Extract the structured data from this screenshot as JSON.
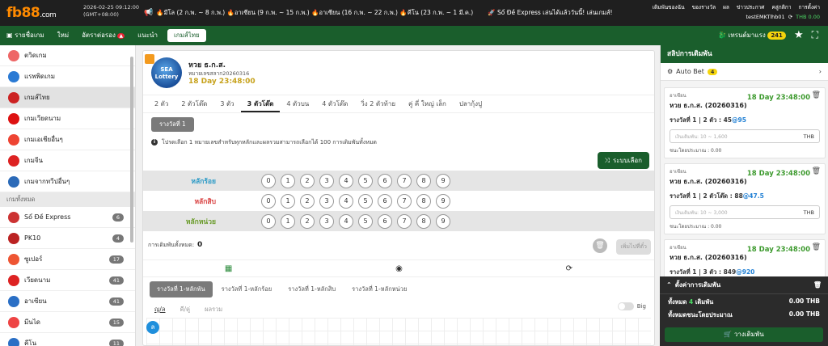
{
  "header": {
    "logo_main": "fb88",
    "logo_dot": ".com",
    "date": "2026-02-25 09:12:00",
    "tz": "(GMT+08:00)",
    "ticker": "🔥มีโล (2 ก.พ. ~ 8 ก.พ.) 🔥อาเซียน (9 ก.พ. ~ 15 ก.พ.) 🔥อาเซียน (16 ก.พ. ~ 22 ก.พ.) 🔥คีโน (23 ก.พ. ~ 1 มี.ค.)",
    "ticker2": "🚀 Sổ Đề Express เล่นได้แล้ววันนี้! เล่นเกมส์!",
    "links": [
      "เดิมพันของฉัน",
      "ของรางวัล",
      "ผล",
      "ข่าวประกาศ",
      "คลู่กติกา",
      "การตั้งค่า"
    ],
    "user": "testEMKTlhb01",
    "balance": "THB 0.00"
  },
  "nav": {
    "items": [
      "รายชื่อเกม",
      "ใหม่",
      "อัตราต่อรอง",
      "แนะนำ",
      "เกมส์ไทย"
    ],
    "promo": "เทรนด์มาแรง",
    "promo_count": "241"
  },
  "sidebar": {
    "items": [
      "ตวิดเกม",
      "แรพพิดเกม",
      "เกมส์ไทย",
      "เกมเวียดนาม",
      "เกมเอเชียอื่นๆ",
      "เกมจีน",
      "เกมจากทวีปอื่นๆ"
    ],
    "section": "เกมทั้งหมด",
    "games": [
      {
        "name": "Sổ Đề Express",
        "count": "6"
      },
      {
        "name": "PK10",
        "count": "4"
      },
      {
        "name": "ซูเปอร์",
        "count": "17"
      },
      {
        "name": "เวียดนาม",
        "count": "41"
      },
      {
        "name": "อาเซียน",
        "count": "41"
      },
      {
        "name": "มีนได",
        "count": "15"
      },
      {
        "name": "คีโน",
        "count": "11"
      }
    ]
  },
  "game": {
    "logo_text": "SEA Lottery",
    "title": "หวย ธ.ก.ส.",
    "draw": "หมายเลขสลาก20260316",
    "time": "18 Day 23:48:00",
    "tabs": [
      "2 ตัว",
      "2 ตัวโต๊ด",
      "3 ตัว",
      "3 ตัวโต๊ด",
      "4 ตัวบน",
      "4 ตัวโต๊ด",
      "วิ่ง 2 ตัวท้าย",
      "คู่ คี่ ใหญ่ เล็ก",
      "ปลากุ้งปู"
    ],
    "round": "รางวัลที่ 1",
    "info": "โปรดเลือก 1 หมายเลขสำหรับทุกหลักและผลรวมสามารถเลือกได้ 100 การเดิมพันทั้งหมด",
    "random_btn": "ระบบเลือก",
    "rows": [
      {
        "label": "หลักร้อย",
        "color": "#2b9ac6"
      },
      {
        "label": "หลักสิบ",
        "color": "#d94343"
      },
      {
        "label": "หลักหน่วย",
        "color": "#6a9b2a"
      }
    ],
    "digits": [
      "0",
      "1",
      "2",
      "3",
      "4",
      "5",
      "6",
      "7",
      "8",
      "9"
    ],
    "total_label": "การเดิมพันทั้งหมด:",
    "total": "0",
    "add_btn": "เพิ่มไปที่ตั๋ว",
    "subtabs": [
      "รางวัลที่ 1-หลักพัน",
      "รางวัลที่ 1-หลักร้อย",
      "รางวัลที่ 1-หลักสิบ",
      "รางวัลที่ 1-หลักหน่วย"
    ],
    "grid_tabs": [
      "ญ/ล",
      "คี/คู่",
      "ผลรวม"
    ],
    "toggle": "Big",
    "bead": "ล"
  },
  "slip": {
    "title": "สลิปการเดิมพัน",
    "autobet": "Auto Bet",
    "autobet_count": "4",
    "cards": [
      {
        "type": "อาเซียน",
        "name": "หวย ธ.ก.ส. (20260316)",
        "time": "18 Day 23:48:00",
        "bet": "รางวัลที่ 1 | 2 ตัว : 45",
        "odds": "@95",
        "placeholder": "เงินเดิมพัน: 10 ~ 1,600",
        "cur": "THB",
        "pay": "ชนะโดยประมาณ : 0.00"
      },
      {
        "type": "อาเซียน",
        "name": "หวย ธ.ก.ส. (20260316)",
        "time": "18 Day 23:48:00",
        "bet": "รางวัลที่ 1 | 2 ตัวโต๊ด : 88",
        "odds": "@47.5",
        "placeholder": "เงินเดิมพัน: 10 ~ 3,000",
        "cur": "THB",
        "pay": "ชนะโดยประมาณ : 0.00"
      },
      {
        "type": "อาเซียน",
        "name": "หวย ธ.ก.ส. (20260316)",
        "time": "18 Day 23:48:00",
        "bet": "รางวัลที่ 1 | 3 ตัว : 849",
        "odds": "@920"
      }
    ],
    "settings": "ตั้งค่าการเดิมพัน",
    "total_label": "ทั้งหมด",
    "total_count": "4",
    "total_unit": "เดิมพัน",
    "total_val": "0.00 THB",
    "win_label": "ทั้งหมดชนะโดยประมาณ",
    "win_val": "0.00 THB",
    "place": "วางเดิมพัน"
  }
}
